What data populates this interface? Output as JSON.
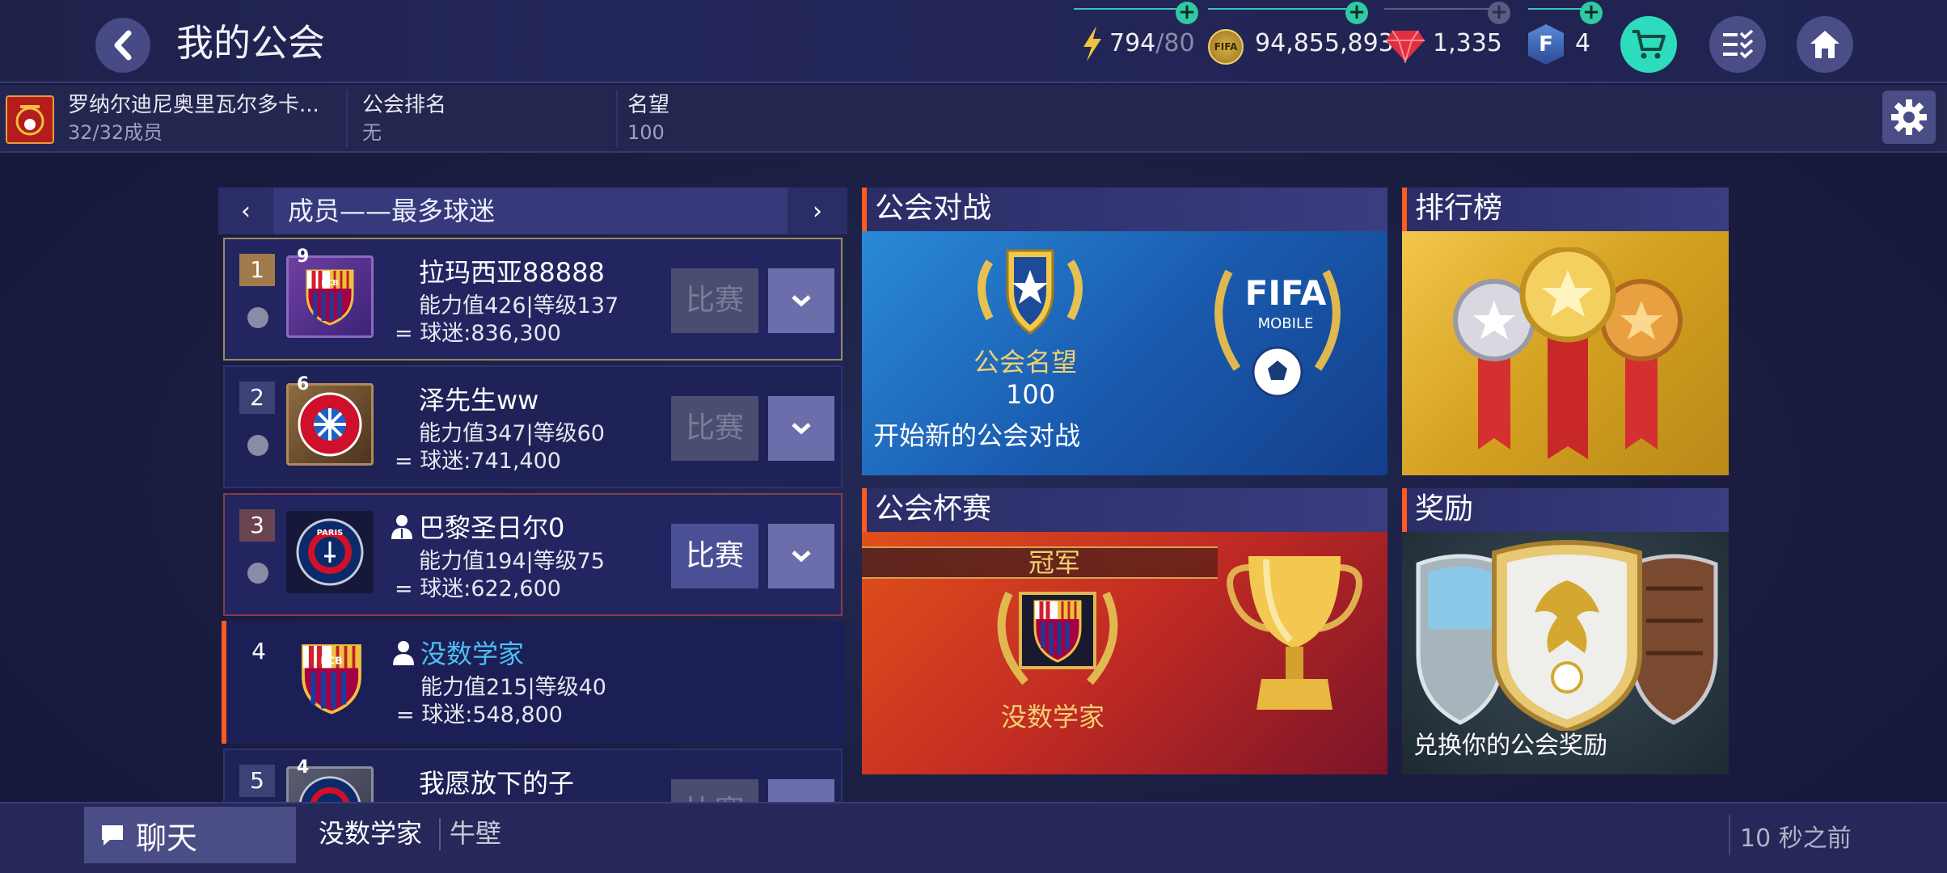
{
  "header": {
    "title": "我的公会"
  },
  "resources": {
    "energy": {
      "value": "794",
      "max": "/80"
    },
    "coins": {
      "value": "94,855,893",
      "icon_text": "FIFA"
    },
    "gems": {
      "value": "1,335"
    },
    "fifa_points": {
      "value": "4",
      "icon_text": "F"
    }
  },
  "guild": {
    "name": "罗纳尔迪尼奥里瓦尔多卡...",
    "members": "32/32成员",
    "rank_label": "公会排名",
    "rank_value": "无",
    "prestige_label": "名望",
    "prestige_value": "100"
  },
  "member_list": {
    "title": "成员——最多球迷",
    "prev": "‹",
    "next": "›",
    "members": [
      {
        "rank": "1",
        "name": "拉玛西亚88888",
        "stats": "能力值426|等级137",
        "fans": "球迷:836,300",
        "match": "比赛",
        "badge_level": "9",
        "club": "FCB"
      },
      {
        "rank": "2",
        "name": "泽先生ww",
        "stats": "能力值347|等级60",
        "fans": "球迷:741,400",
        "match": "比赛",
        "badge_level": "6",
        "club": "FCB"
      },
      {
        "rank": "3",
        "name": "巴黎圣日尔0",
        "stats": "能力值194|等级75",
        "fans": "球迷:622,600",
        "match": "比赛",
        "badge_level": "",
        "club": "PARIS"
      },
      {
        "rank": "4",
        "name": "没数学家",
        "stats": "能力值215|等级40",
        "fans": "球迷:548,800",
        "match": "",
        "badge_level": "",
        "club": "FCB"
      },
      {
        "rank": "5",
        "name": "我愿放下的子",
        "stats": "",
        "fans": "",
        "match": "比赛",
        "badge_level": "4",
        "club": "PARIS"
      }
    ]
  },
  "panels": {
    "guild_battle": {
      "title": "公会对战",
      "prestige_label": "公会名望",
      "prestige_value": "100",
      "logo_text": "FIFA",
      "logo_sub": "MOBILE",
      "caption": "开始新的公会对战"
    },
    "leaderboard": {
      "title": "排行榜"
    },
    "guild_cup": {
      "title": "公会杯赛",
      "champion_label": "冠军",
      "champion_name": "没数学家",
      "club": "FCB"
    },
    "rewards": {
      "title": "奖励",
      "caption": "兑换你的公会奖励"
    }
  },
  "chat": {
    "button": "聊天",
    "user": "没数学家",
    "message": "牛壁",
    "time": "10 秒之前"
  },
  "colors": {
    "accent": "#ff5a20",
    "teal": "#2fcaa3",
    "highlight_name": "#4dc0f2"
  }
}
